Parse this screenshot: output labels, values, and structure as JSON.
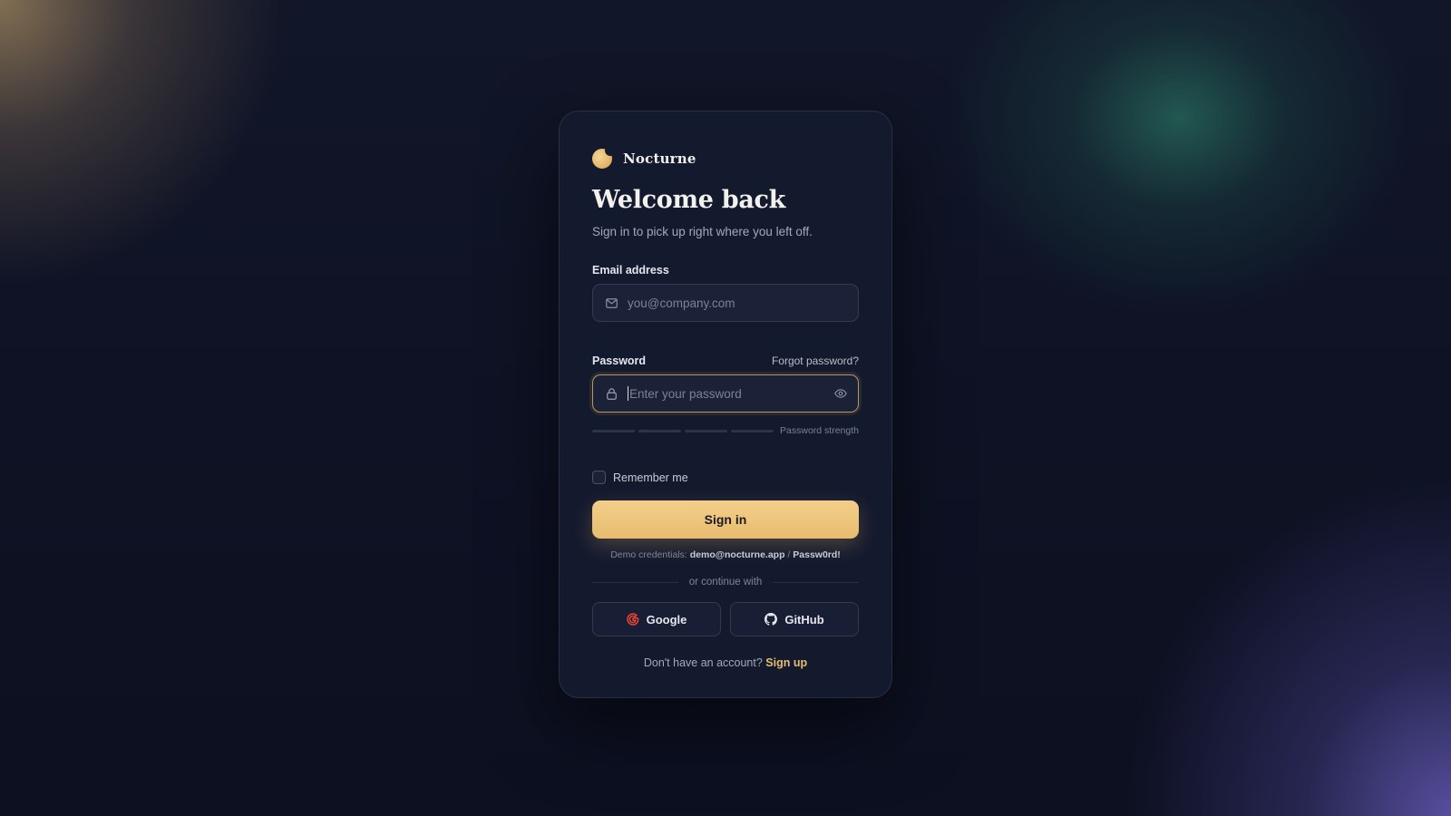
{
  "brand": {
    "name": "Nocturne",
    "logo_icon": "crescent-moon-icon"
  },
  "heading": {
    "title": "Welcome back",
    "subtitle": "Sign in to pick up right where you left off."
  },
  "email": {
    "label": "Email address",
    "placeholder": "you@company.com",
    "value": "",
    "icon": "mail-icon"
  },
  "password": {
    "label": "Password",
    "forgot_label": "Forgot password?",
    "placeholder": "Enter your password",
    "value": "",
    "icon": "lock-icon",
    "toggle_icon": "eye-icon",
    "strength_label": "Password strength",
    "strength_level": 0,
    "strength_segments": 4
  },
  "remember": {
    "label": "Remember me",
    "checked": false
  },
  "signin": {
    "label": "Sign in"
  },
  "demo": {
    "prefix": "Demo credentials:",
    "email": "demo@nocturne.app",
    "separator": "/",
    "password": "Passw0rd!"
  },
  "divider": {
    "text": "or continue with"
  },
  "social": {
    "google": {
      "label": "Google",
      "icon": "google-icon"
    },
    "github": {
      "label": "GitHub",
      "icon": "github-icon"
    }
  },
  "signup": {
    "prompt": "Don't have an account?",
    "link_label": "Sign up"
  },
  "colors": {
    "accent": "#e8bc70",
    "background": "#0d1020",
    "card": "#141a2e",
    "google_red": "#ea4335"
  }
}
